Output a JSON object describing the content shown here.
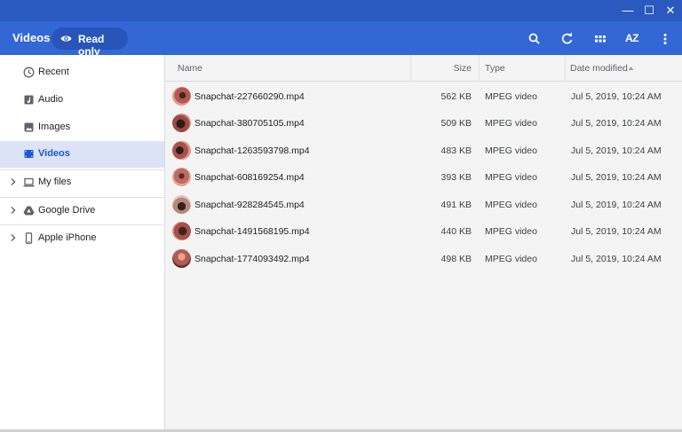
{
  "window": {
    "controls": {
      "minimize": "—",
      "maximize": "☐",
      "close": "✕"
    }
  },
  "appbar": {
    "title": "Videos",
    "read_only_label": "Read only",
    "sort_label": "AZ"
  },
  "sidebar": {
    "items": [
      {
        "label": "Recent",
        "icon": "clock-icon",
        "active": false
      },
      {
        "label": "Audio",
        "icon": "audio-icon",
        "active": false
      },
      {
        "label": "Images",
        "icon": "image-icon",
        "active": false
      },
      {
        "label": "Videos",
        "icon": "video-icon",
        "active": true
      }
    ],
    "roots": [
      {
        "label": "My files",
        "icon": "laptop-icon"
      },
      {
        "label": "Google Drive",
        "icon": "drive-icon"
      },
      {
        "label": "Apple iPhone",
        "icon": "phone-icon"
      }
    ]
  },
  "table": {
    "headers": {
      "name": "Name",
      "size": "Size",
      "type": "Type",
      "date": "Date modified"
    },
    "rows": [
      {
        "name": "Snapchat-227660290.mp4",
        "size": "562 KB",
        "type": "MPEG video",
        "date": "Jul 5, 2019, 10:24 AM"
      },
      {
        "name": "Snapchat-380705105.mp4",
        "size": "509 KB",
        "type": "MPEG video",
        "date": "Jul 5, 2019, 10:24 AM"
      },
      {
        "name": "Snapchat-1263593798.mp4",
        "size": "483 KB",
        "type": "MPEG video",
        "date": "Jul 5, 2019, 10:24 AM"
      },
      {
        "name": "Snapchat-608169254.mp4",
        "size": "393 KB",
        "type": "MPEG video",
        "date": "Jul 5, 2019, 10:24 AM"
      },
      {
        "name": "Snapchat-928284545.mp4",
        "size": "491 KB",
        "type": "MPEG video",
        "date": "Jul 5, 2019, 10:24 AM"
      },
      {
        "name": "Snapchat-1491568195.mp4",
        "size": "440 KB",
        "type": "MPEG video",
        "date": "Jul 5, 2019, 10:24 AM"
      },
      {
        "name": "Snapchat-1774093492.mp4",
        "size": "498 KB",
        "type": "MPEG video",
        "date": "Jul 5, 2019, 10:24 AM"
      }
    ]
  },
  "colors": {
    "titlebar": "#2a5ac0",
    "appbar": "#3367d6",
    "active_nav_bg": "#dde3f6",
    "active_nav_text": "#1a56d6"
  }
}
